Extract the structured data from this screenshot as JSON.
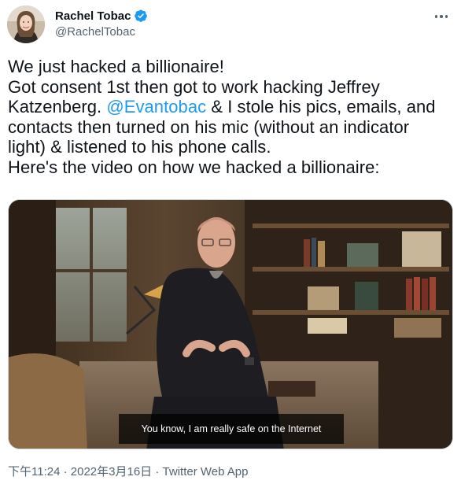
{
  "author": {
    "display_name": "Rachel Tobac",
    "handle": "@RachelTobac",
    "verified": true,
    "avatar_icon": "profile-photo"
  },
  "tweet": {
    "lines": [
      {
        "text": "We just hacked a billionaire!"
      },
      {
        "text": "Got consent 1st then got to work hacking Jeffrey"
      },
      {
        "before": "Katzenberg. ",
        "mention": "@Evantobac",
        "after": " & I stole his pics, emails, and"
      },
      {
        "text": "contacts then turned on his mic (without an indicator"
      },
      {
        "text": "light) & listened to his phone calls."
      },
      {
        "text": "Here's the video on how we hacked a billionaire:"
      }
    ]
  },
  "media": {
    "type": "video",
    "caption": "You know, I am really safe on the Internet"
  },
  "meta": {
    "time": "下午11:24",
    "date": "2022年3月16日",
    "separator": "·",
    "source": "Twitter Web App"
  },
  "colors": {
    "accent": "#1d9bf0",
    "text": "#0f1419",
    "muted": "#536471"
  }
}
